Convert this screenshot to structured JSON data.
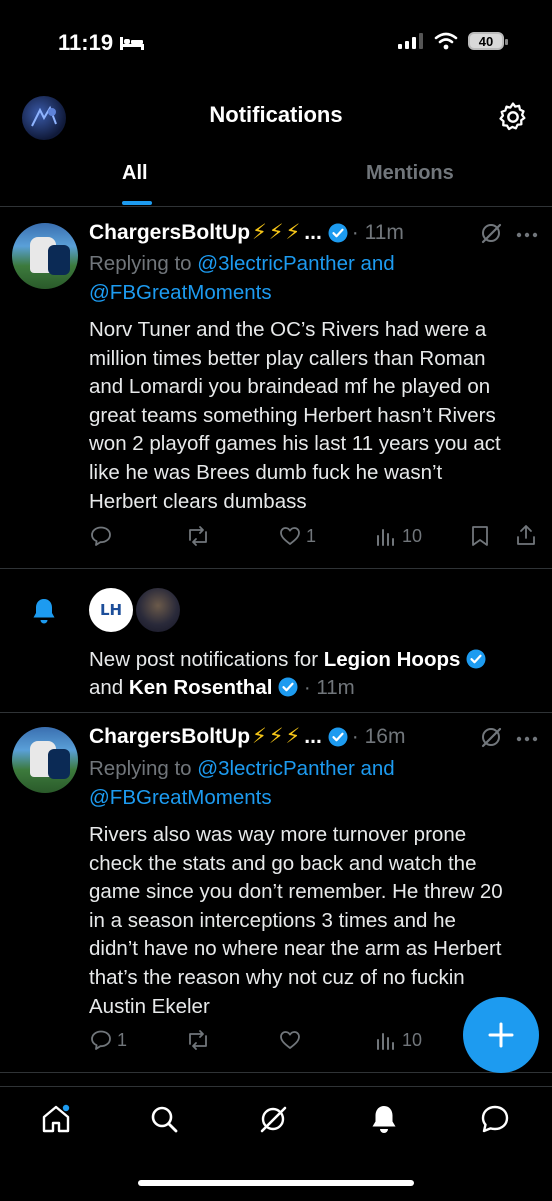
{
  "status_bar": {
    "time": "11:19",
    "battery": "40"
  },
  "header": {
    "title": "Notifications"
  },
  "tabs": [
    {
      "label": "All"
    },
    {
      "label": "Mentions"
    }
  ],
  "posts": [
    {
      "name": "ChargersBoltUp",
      "bolts": "⚡⚡⚡",
      "ellipsis": "...",
      "time": "· 11m",
      "replying_prefix": "Replying to ",
      "replying_to_1": "@3lectricPanther and",
      "replying_to_2": "@FBGreatMoments",
      "lines": [
        "Norv Tuner and the OC’s Rivers had were a",
        "million times better play callers than Roman",
        "and Lomardi you braindead mf he played on",
        "great teams something Herbert hasn’t Rivers",
        "won 2 playoff games his last 11 years you act",
        "like he was Brees dumb fuck he wasn’t",
        "Herbert clears dumbass"
      ],
      "reply_count": "",
      "like_count": "1",
      "views": "10"
    },
    {
      "name": "ChargersBoltUp",
      "bolts": "⚡⚡⚡",
      "ellipsis": "...",
      "time": "· 16m",
      "replying_prefix": "Replying to ",
      "replying_to_1": "@3lectricPanther and",
      "replying_to_2": "@FBGreatMoments",
      "lines": [
        "Rivers also was way more turnover prone",
        "check the stats and go back and watch the",
        "game since you don’t remember. He threw 20",
        "in a season interceptions 3 times and he",
        "didn’t have no where near the arm as Herbert",
        "that’s the reason why not cuz of no fuckin",
        "Austin Ekeler"
      ],
      "reply_count": "1",
      "like_count": "",
      "views": "10"
    }
  ],
  "notification": {
    "prefix": "New post notifications for ",
    "account_1": "Legion Hoops",
    "connector": "and ",
    "account_2": "Ken Rosenthal",
    "time": "· 11m",
    "avatar_1_text": "LH"
  },
  "colors": {
    "accent": "#1d9bf0",
    "background": "#000000",
    "muted": "#71767b"
  }
}
